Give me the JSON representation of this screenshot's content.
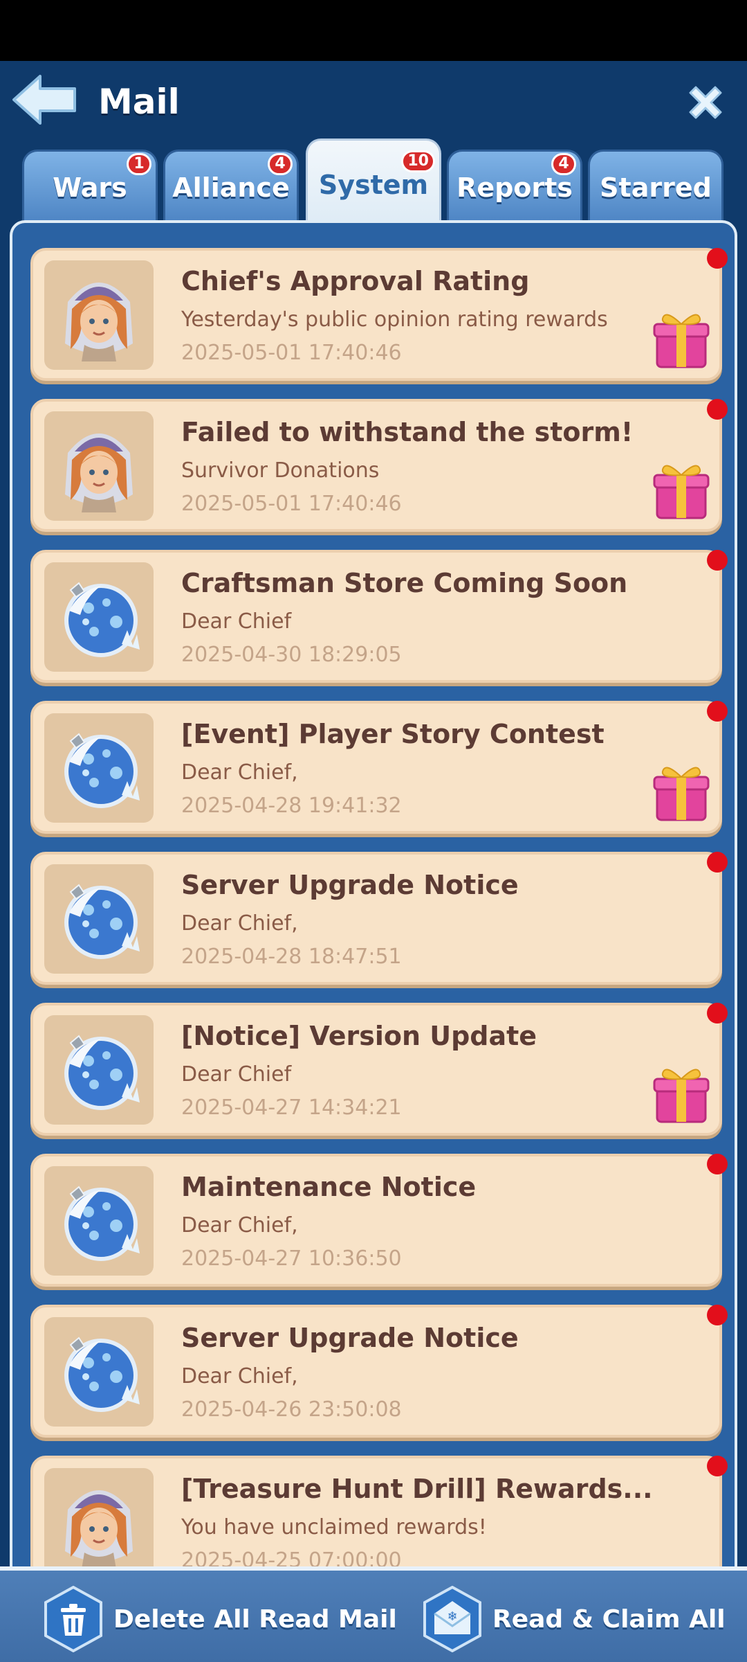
{
  "header": {
    "title": "Mail"
  },
  "tabs": [
    {
      "label": "Wars",
      "badge": "1"
    },
    {
      "label": "Alliance",
      "badge": "4"
    },
    {
      "label": "System",
      "badge": "10"
    },
    {
      "label": "Reports",
      "badge": "4"
    },
    {
      "label": "Starred",
      "badge": ""
    }
  ],
  "active_tab": "System",
  "mails": [
    {
      "title": "Chief's Approval Rating",
      "subtitle": "Yesterday's public opinion rating rewards",
      "date": "2025-05-01 17:40:46",
      "avatar": "chief-girl-avatar",
      "gift": true,
      "unread": true
    },
    {
      "title": "Failed to withstand the storm!",
      "subtitle": "Survivor Donations",
      "date": "2025-05-01 17:40:46",
      "avatar": "chief-girl-avatar",
      "gift": true,
      "unread": true
    },
    {
      "title": "Craftsman Store Coming Soon",
      "subtitle": "Dear Chief",
      "date": "2025-04-30 18:29:05",
      "avatar": "snow-globe-icon",
      "gift": false,
      "unread": true
    },
    {
      "title": "[Event] Player Story Contest",
      "subtitle": "Dear Chief,",
      "date": "2025-04-28 19:41:32",
      "avatar": "snow-globe-icon",
      "gift": true,
      "unread": true
    },
    {
      "title": "Server Upgrade Notice",
      "subtitle": "Dear Chief,",
      "date": "2025-04-28 18:47:51",
      "avatar": "snow-globe-icon",
      "gift": false,
      "unread": true
    },
    {
      "title": "[Notice] Version Update",
      "subtitle": "Dear Chief",
      "date": "2025-04-27 14:34:21",
      "avatar": "snow-globe-icon",
      "gift": true,
      "unread": true
    },
    {
      "title": "Maintenance Notice",
      "subtitle": "Dear Chief,",
      "date": "2025-04-27 10:36:50",
      "avatar": "snow-globe-icon",
      "gift": false,
      "unread": true
    },
    {
      "title": "Server Upgrade Notice",
      "subtitle": "Dear Chief,",
      "date": "2025-04-26 23:50:08",
      "avatar": "snow-globe-icon",
      "gift": false,
      "unread": true
    },
    {
      "title": "[Treasure Hunt Drill] Rewards...",
      "subtitle": "You have unclaimed rewards!",
      "date": "2025-04-25 07:00:00",
      "avatar": "chief-girl-avatar",
      "gift": false,
      "unread": true
    }
  ],
  "footer": {
    "delete_label": "Delete All Read Mail",
    "claim_label": "Read & Claim All"
  },
  "colors": {
    "background": "#0f3a6b",
    "panel": "#2a62a3",
    "card": "#f8e3c8",
    "unread_dot": "#e20f1b",
    "badge": "#d72a2a"
  }
}
